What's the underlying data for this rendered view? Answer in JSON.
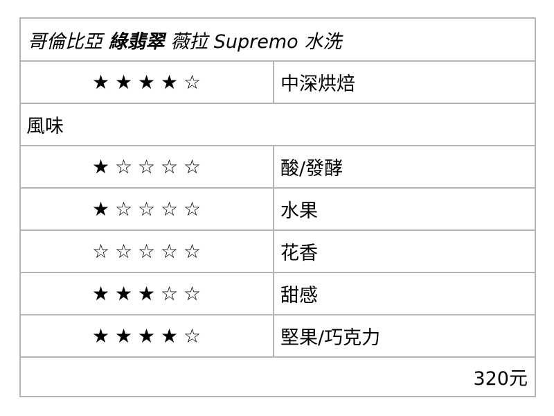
{
  "title": {
    "origin": "哥倫比亞",
    "name": "綠翡翠",
    "variety": "薇拉 Supremo 水洗"
  },
  "roast": {
    "rating": 4,
    "max": 5,
    "label": "中深烘焙"
  },
  "flavor_section": {
    "label": "風味"
  },
  "flavors": [
    {
      "rating": 1,
      "max": 5,
      "label": "酸/發酵"
    },
    {
      "rating": 1,
      "max": 5,
      "label": "水果"
    },
    {
      "rating": 0,
      "max": 5,
      "label": "花香"
    },
    {
      "rating": 3,
      "max": 5,
      "label": "甜感"
    },
    {
      "rating": 4,
      "max": 5,
      "label": "堅果/巧克力"
    }
  ],
  "price": "320元",
  "icons": {
    "filled_star": "star-filled-icon",
    "empty_star": "star-empty-icon"
  }
}
